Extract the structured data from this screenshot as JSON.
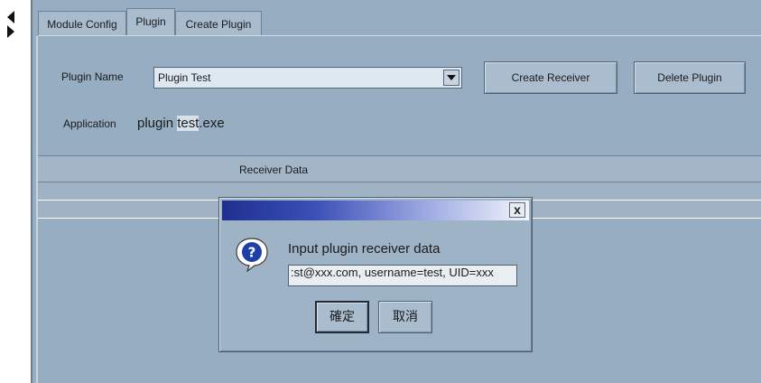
{
  "tabs": [
    {
      "label": "Module Config"
    },
    {
      "label": "Plugin",
      "active": true
    },
    {
      "label": "Create Plugin"
    }
  ],
  "plugin_form": {
    "plugin_name_label": "Plugin Name",
    "plugin_name_value": "Plugin Test",
    "application_label": "Application",
    "application_value_prefix": "plugin ",
    "application_value_highlight": "test",
    "application_value_suffix": ".exe",
    "create_receiver_label": "Create Receiver",
    "delete_plugin_label": "Delete Plugin"
  },
  "receiver_grid": {
    "header": "Receiver Data"
  },
  "dialog": {
    "close_symbol": "x",
    "message": "Input plugin receiver data",
    "input_value": ":st@xxx.com, username=test, UID=xxx",
    "ok_label": "確定",
    "cancel_label": "取消"
  },
  "colors": {
    "panel": "#96adc2",
    "title_gradient_start": "#1e2f8f",
    "title_gradient_end": "#f3f5fb"
  }
}
